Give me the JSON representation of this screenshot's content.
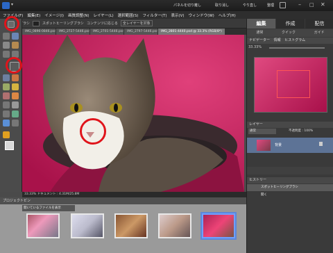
{
  "window": {
    "home_icon": "home-icon",
    "menu_button": "▾"
  },
  "titlebar": {
    "commands": [
      "パネルを切り離し",
      "取り消し",
      "やり直し",
      "整理",
      "作成"
    ],
    "win_controls": [
      "–",
      "□",
      "✕"
    ]
  },
  "menu": [
    "ファイル(F)",
    "編集(E)",
    "イメージ(I)",
    "画質調整(N)",
    "レイヤー(L)",
    "選択範囲(S)",
    "フィルター(T)",
    "表示(V)",
    "ウィンドウ(W)",
    "ヘルプ(H)"
  ],
  "options": {
    "brush": "ブラシ",
    "spot": "スポットヒーリングブラシ",
    "content": "コンテンツに応じる",
    "sample_all": "全レイヤーを対象"
  },
  "doc_tabs": [
    "IMG_0896-0846.psd",
    "IMG_2727-5446.psd",
    "IMG_2701-5446.psd",
    "IMG_2797-5446.psd",
    "IMG_2801-4440.psd @ 33.3% (RGB/8*)"
  ],
  "status": "33.33%   ドキュメント : 4.31M/25.8M",
  "bin": {
    "title": "プロジェクトビン",
    "dropdown": "開いているファイルを表示"
  },
  "panel": {
    "tabs": [
      "編集",
      "作成",
      "配信"
    ],
    "subtabs": [
      "通常",
      "クイック",
      "ガイド"
    ],
    "navigator": {
      "title": "ナビゲーター",
      "tabs": [
        "情報",
        "ヒストグラム"
      ],
      "zoom": "33.33%"
    },
    "layers": {
      "title": "レイヤー",
      "mode": "通常",
      "opacity": "不透明度 : 100%",
      "layer_name": "背景"
    },
    "history": {
      "title": "ヒストリー",
      "items": [
        "スポットヒーリングブラシ",
        "開く"
      ]
    }
  },
  "colors": {
    "accent": "#e0141b",
    "canvas_pink": "#c0205a",
    "panel": "#3a3a3a"
  }
}
